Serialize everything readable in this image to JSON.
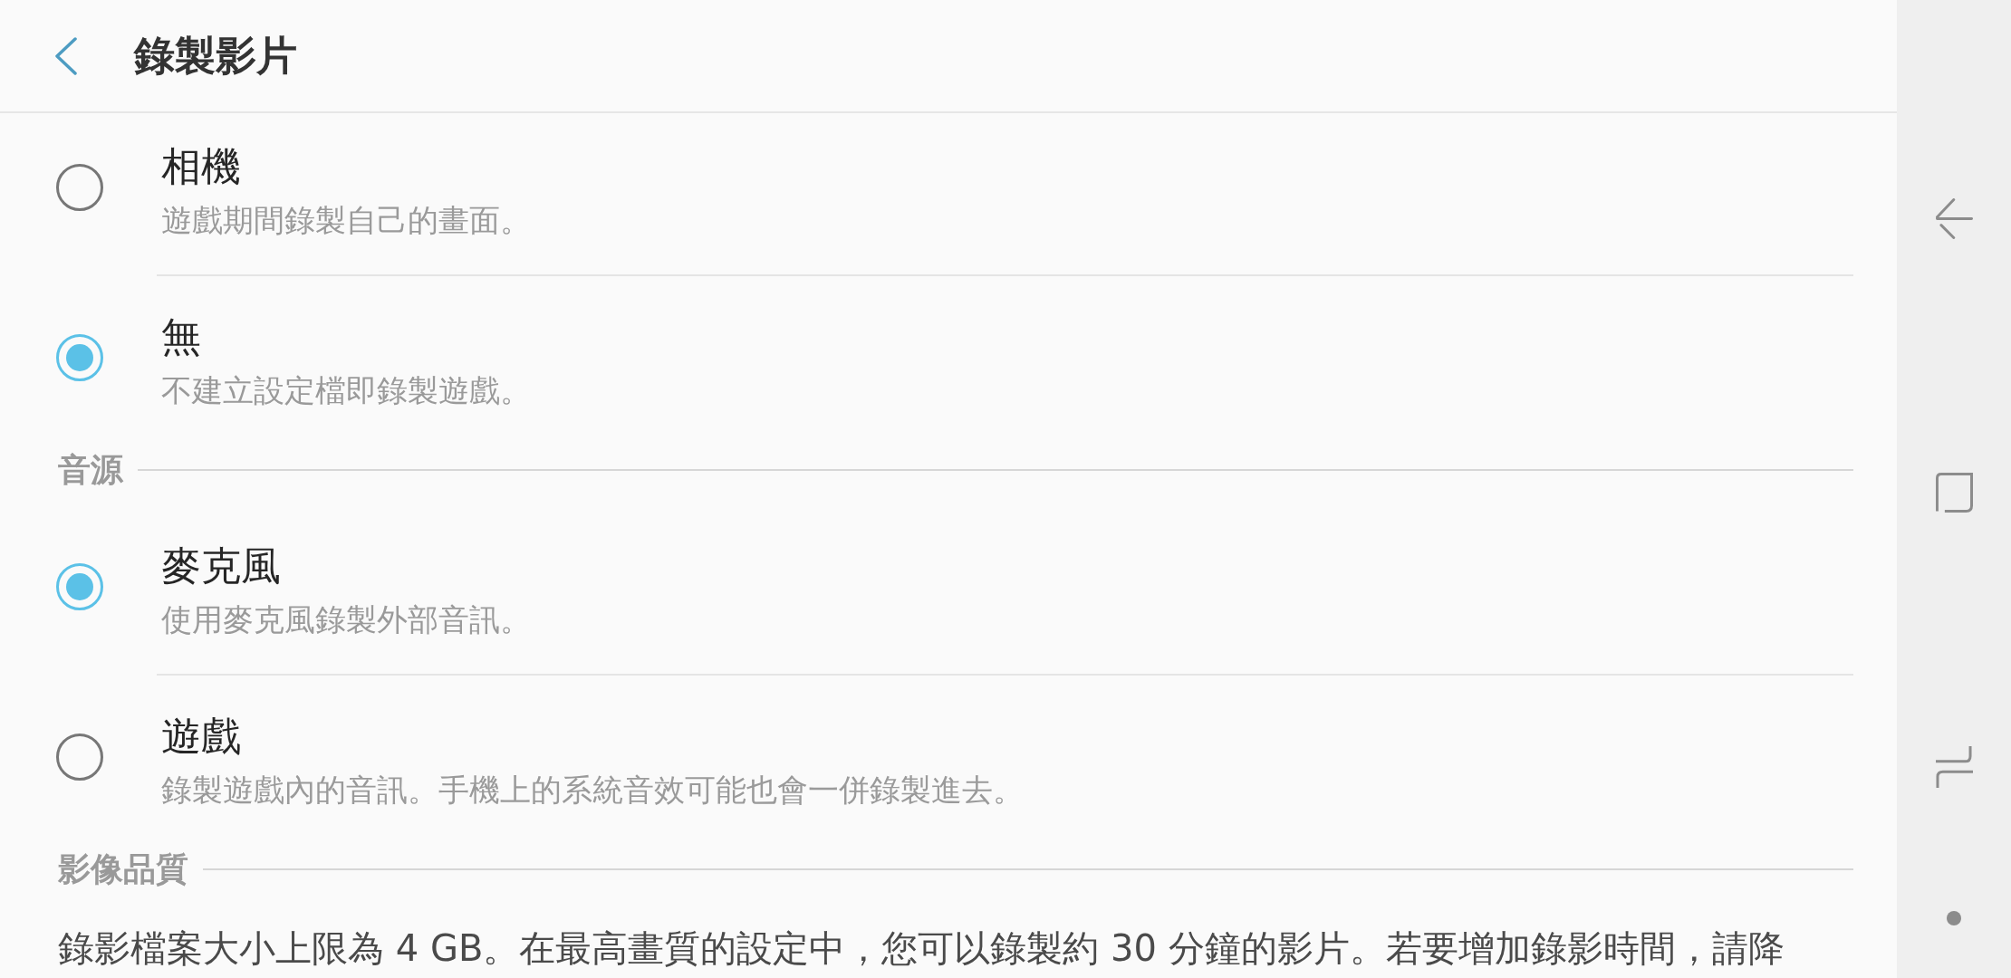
{
  "app_bar": {
    "title": "錄製影片"
  },
  "top_options": [
    {
      "title": "相機",
      "description": "遊戲期間錄製自己的畫面。",
      "selected": false
    },
    {
      "title": "無",
      "description": "不建立設定檔即錄製遊戲。",
      "selected": true
    }
  ],
  "audio_source": {
    "heading": "音源",
    "options": [
      {
        "title": "麥克風",
        "description": "使用麥克風錄製外部音訊。",
        "selected": true
      },
      {
        "title": "遊戲",
        "description": "錄製遊戲內的音訊。手機上的系統音效可能也會一併錄製進去。",
        "selected": false
      }
    ]
  },
  "video_quality": {
    "heading": "影像品質",
    "description": "錄影檔案大小上限為 4 GB。在最高畫質的設定中，您可以錄製約 30 分鐘的影片。若要增加錄影時間，請降"
  }
}
